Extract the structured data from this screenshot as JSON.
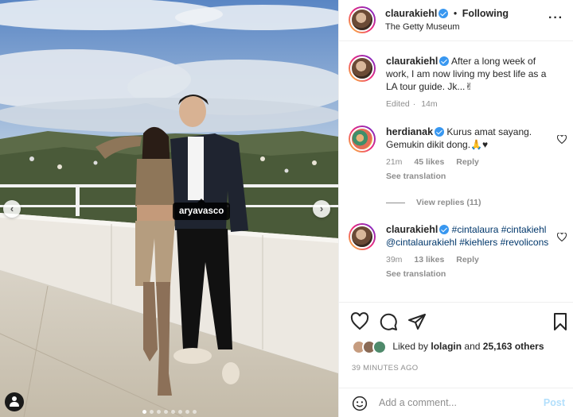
{
  "photo": {
    "tag_label": "aryavasco",
    "nav_prev_icon": "chevron-left-icon",
    "nav_next_icon": "chevron-right-icon",
    "carousel_count": 8,
    "carousel_active": 1
  },
  "header": {
    "username": "claurakiehl",
    "separator": "•",
    "follow_state": "Following",
    "location": "The Getty Museum",
    "more_icon": "more-horizontal-icon"
  },
  "caption": {
    "username": "claurakiehl",
    "text": "After a long week of work, I am now living my best life as a LA tour guide. Jk...✌",
    "edited": "Edited",
    "time": "14m"
  },
  "comments": [
    {
      "username": "herdianak",
      "text": "Kurus amat sayang. Gemukin dikit dong.🙏♥",
      "time": "21m",
      "likes": "45 likes",
      "reply": "Reply",
      "see_translation": "See translation",
      "view_replies": "View replies (11)"
    },
    {
      "username": "claurakiehl",
      "text": "#cintalaura #cintakiehl @cintalaurakiehl #kiehlers #revolicons",
      "time": "39m",
      "likes": "13 likes",
      "reply": "Reply",
      "see_translation": "See translation"
    }
  ],
  "actions": {
    "like_icon": "heart-icon",
    "comment_icon": "comment-icon",
    "share_icon": "share-icon",
    "save_icon": "bookmark-icon"
  },
  "likes": {
    "prefix": "Liked by",
    "user": "lolagin",
    "and": "and",
    "others": "25,163 others"
  },
  "timestamp": "39 MINUTES AGO",
  "add_comment": {
    "emoji_icon": "emoji-icon",
    "placeholder": "Add a comment...",
    "post_label": "Post"
  },
  "colors": {
    "verified": "#3897f0",
    "link": "#00376b",
    "post_disabled": "#b2dffc"
  }
}
